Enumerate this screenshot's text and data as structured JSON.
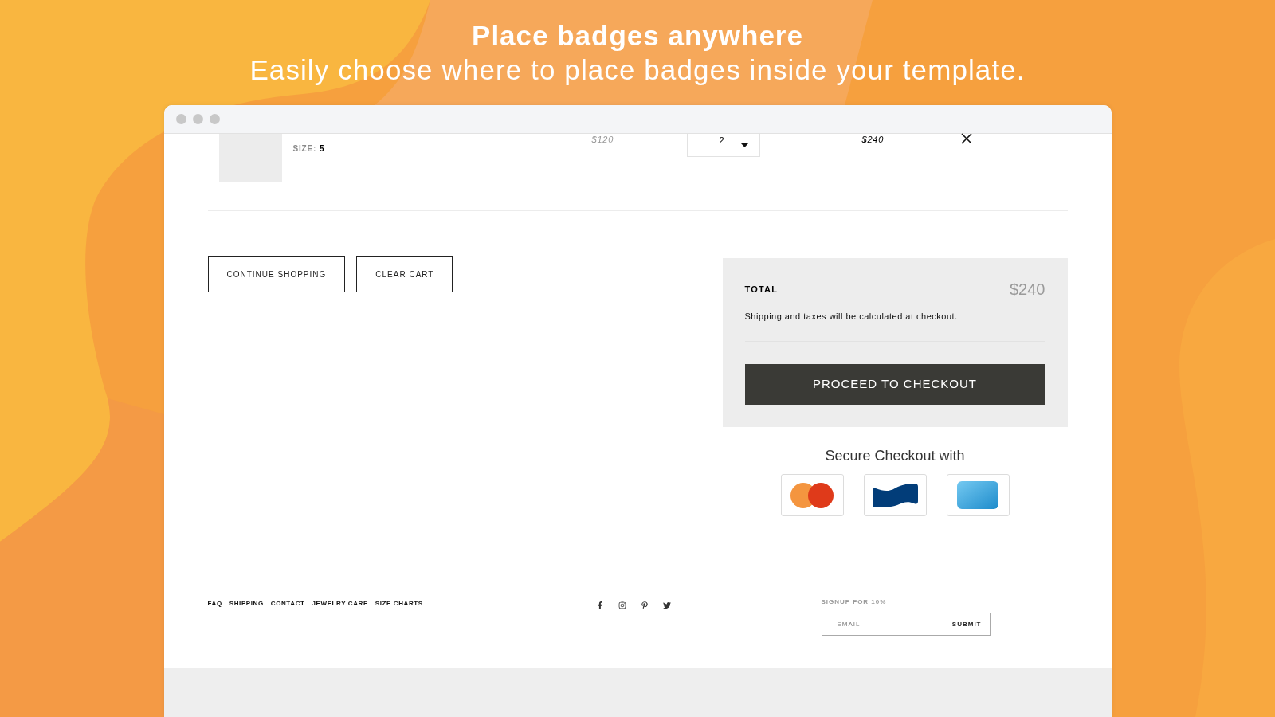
{
  "header": {
    "title": "Place badges anywhere",
    "subtitle": "Easily choose where to place badges inside your template."
  },
  "cart_item": {
    "size_label": "SIZE:",
    "size_value": "5",
    "price": "$120",
    "quantity": "2",
    "line_total": "$240"
  },
  "cart_actions": [
    "CONTINUE SHOPPING",
    "CLEAR CART"
  ],
  "summary": {
    "total_label": "TOTAL",
    "total": "$240",
    "note": "Shipping and taxes will be calculated at checkout.",
    "checkout_button": "PROCEED TO CHECKOUT"
  },
  "secure_checkout": {
    "title": "Secure Checkout with"
  },
  "footer": {
    "links": [
      "FAQ",
      "SHIPPING",
      "CONTACT",
      "JEWELRY CARE",
      "SIZE CHARTS"
    ],
    "signup": {
      "label": "SIGNUP FOR 10%",
      "placeholder": "EMAIL",
      "button": "SUBMIT"
    }
  }
}
